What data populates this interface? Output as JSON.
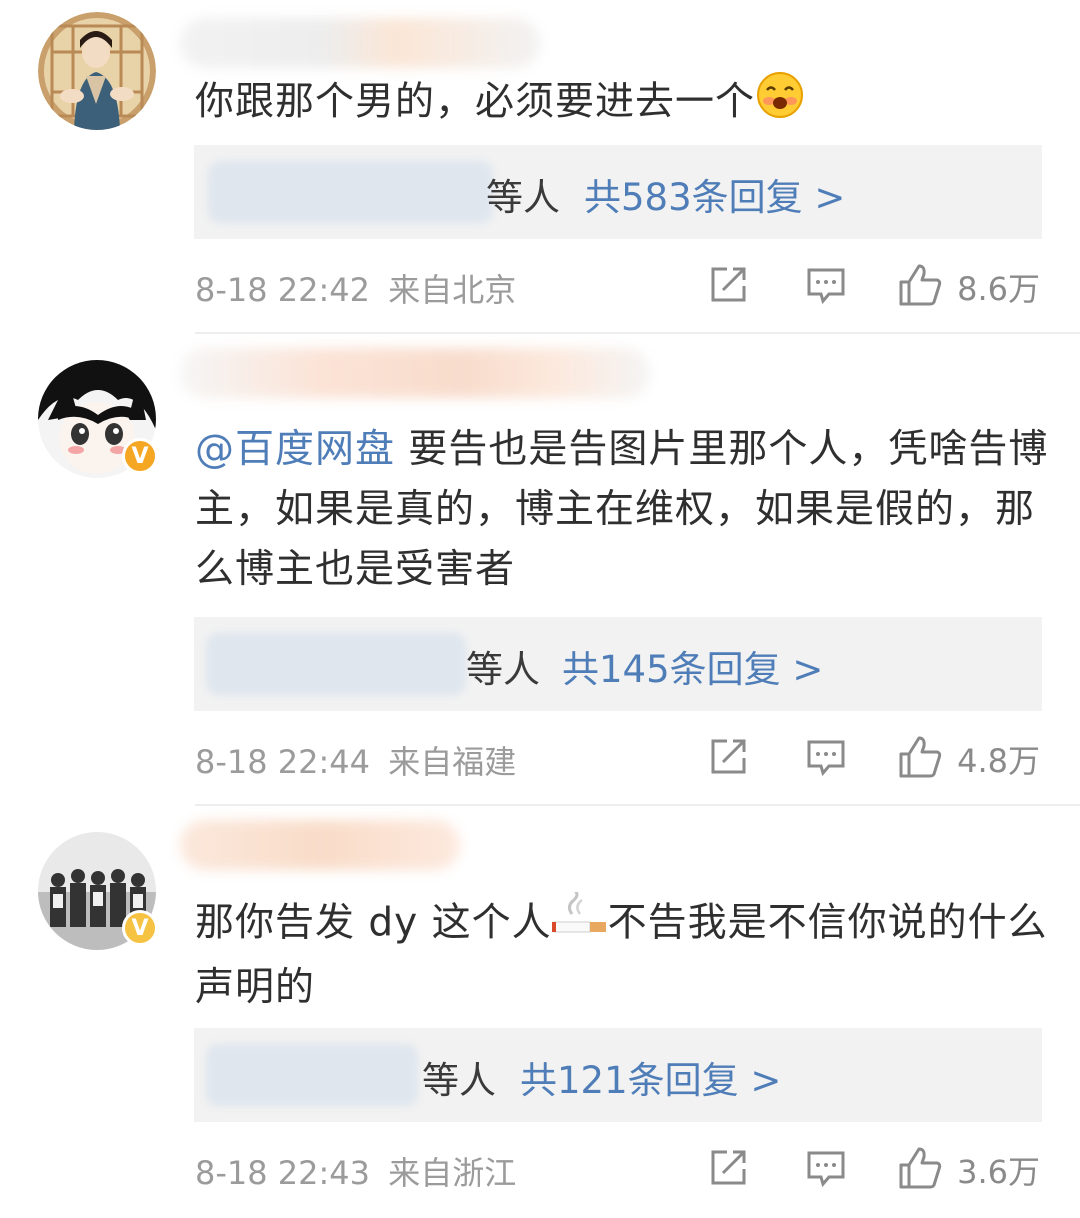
{
  "comments": [
    {
      "text": "你跟那个男的，必须要进去一个",
      "emoji": "blushing-smile-emoji",
      "reply_etc": "等人",
      "reply_count": "共583条回复 >",
      "time": "8-18 22:42",
      "location": "来自北京",
      "likes": "8.6万"
    },
    {
      "mention": "@百度网盘",
      "text": " 要告也是告图片里那个人，凭啥告博主，如果是真的，博主在维权，如果是假的，那么博主也是受害者",
      "badge": "V",
      "badge_color": "#f5a623",
      "reply_etc": "等人",
      "reply_count": "共145条回复 >",
      "time": "8-18 22:44",
      "location": "来自福建",
      "likes": "4.8万"
    },
    {
      "text_before": "那你告发 dy 这个人",
      "emoji": "cigarette-emoji",
      "text_after": "不告我是不信你说的什么声明的",
      "badge": "V",
      "badge_color": "#f5c242",
      "reply_etc": "等人",
      "reply_count": "共121条回复 >",
      "time": "8-18 22:43",
      "location": "来自浙江",
      "likes": "3.6万"
    }
  ],
  "icons": {
    "share": "share-icon",
    "comment": "comment-icon",
    "like": "thumbs-up-icon"
  },
  "colors": {
    "link": "#4f7db8",
    "meta": "#9b9b9b",
    "reply_bg": "#f2f2f2"
  }
}
